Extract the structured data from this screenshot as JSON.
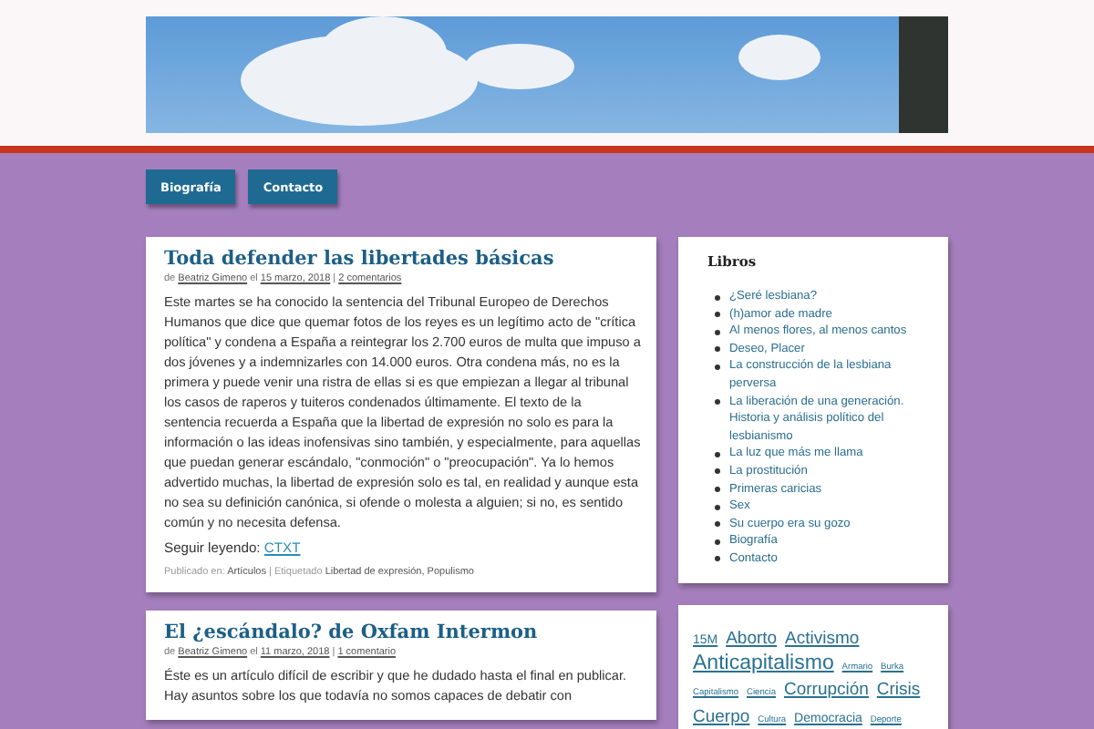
{
  "nav": [
    {
      "label": "Biografía",
      "selected": false
    },
    {
      "label": "Contacto",
      "selected": false
    }
  ],
  "posts": [
    {
      "title": "Toda defender las libertades básicas",
      "by": "de",
      "author": "Beatriz Gimeno",
      "on": "el",
      "date": "15 marzo, 2018",
      "sep": "|",
      "comments": "2 comentarios",
      "sep2": "|",
      "body": "Este martes se ha conocido la sentencia del Tribunal Europeo de Derechos Humanos que dice que quemar fotos de los reyes es un legítimo acto de \"crítica política\" y condena a España a reintegrar los 2.700 euros de multa que impuso a dos jóvenes y a indemnizarles con 14.000 euros. Otra condena más, no es la primera y puede venir una ristra de ellas si es que empiezan a llegar al tribunal los casos de raperos y tuiteros condenados últimamente. El texto de la sentencia recuerda a España que la libertad de expresión no solo es para la información o las ideas inofensivas sino también, y especialmente, para aquellas que puedan generar escándalo, \"conmoción\" o \"preocupación\". Ya lo hemos advertido muchas, la libertad de expresión solo es tal, en realidad y aunque esta no sea su definición canónica, si ofende o molesta  a alguien; si no, es sentido común y no necesita defensa.",
      "more_label": "Seguir leyendo:",
      "more_link": "CTXT",
      "published_label": "Publicado en:",
      "category": "Artículos",
      "tagged_label": "Etiquetado",
      "tags": "Libertad de expresión, Populismo"
    },
    {
      "title": "El ¿escándalo? de Oxfam Intermon",
      "by": "de",
      "author": "Beatriz Gimeno",
      "on": "el",
      "date": "11 marzo, 2018",
      "sep": "|",
      "comments": "1 comentario",
      "body": "Éste es un artículo difícil de escribir y que he dudado hasta el final en publicar. Hay asuntos sobre los que todavía no somos capaces de debatir con"
    }
  ],
  "sidebar": {
    "title": "Libros",
    "items": [
      "¿Seré lesbiana?",
      "(h)amor ade madre",
      "Al menos flores, al menos cantos",
      "Deseo, Placer",
      "La construcción de la lesbiana perversa",
      "La liberación de una generación. Historia y análisis político del lesbianismo",
      "La luz que más me llama",
      "La prostitución",
      "Primeras caricias",
      "Sex",
      "Su cuerpo era su gozo",
      "Biografía",
      "Contacto"
    ]
  },
  "tag_cloud": [
    {
      "label": "15M",
      "kind": "medium"
    },
    {
      "label": "Aborto",
      "kind": "large"
    },
    {
      "label": "Activismo",
      "kind": "large"
    },
    {
      "label": "Anticapitalismo",
      "kind": "xlarge"
    },
    {
      "label": "Armario",
      "kind": "small"
    },
    {
      "label": "Burka",
      "kind": "small"
    },
    {
      "label": "Capitalismo",
      "kind": "small"
    },
    {
      "label": "Ciencia",
      "kind": "small"
    },
    {
      "label": "Corrupción",
      "kind": "large"
    },
    {
      "label": "Crisis",
      "kind": "large"
    },
    {
      "label": "Cuerpo",
      "kind": "large"
    },
    {
      "label": "Cultura",
      "kind": "small"
    },
    {
      "label": "Democracia",
      "kind": "medium"
    },
    {
      "label": "Deporte",
      "kind": "small"
    }
  ]
}
